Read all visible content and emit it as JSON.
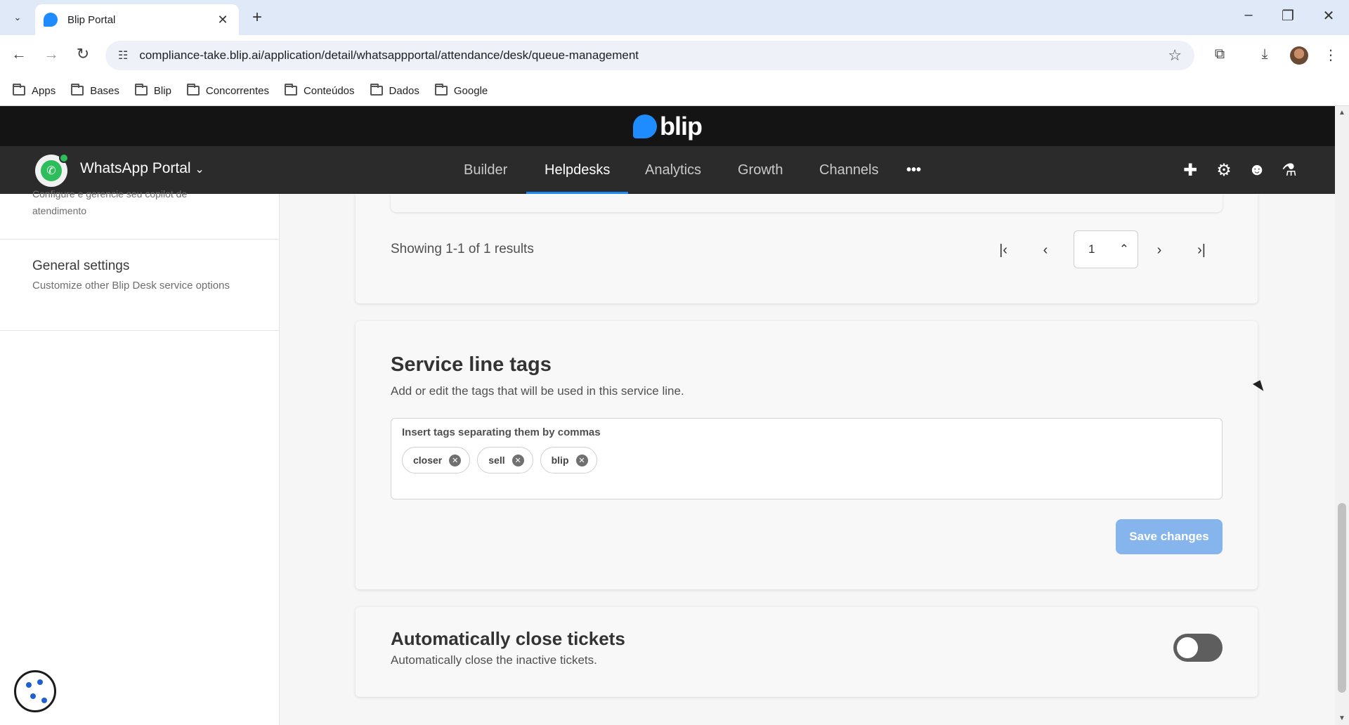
{
  "browser": {
    "tab_title": "Blip Portal",
    "url": "compliance-take.blip.ai/application/detail/whatsappportal/attendance/desk/queue-management",
    "bookmarks": [
      "Apps",
      "Bases",
      "Blip",
      "Concorrentes",
      "Conteúdos",
      "Dados",
      "Google"
    ]
  },
  "header": {
    "brand": "blip",
    "bot_name": "WhatsApp Portal",
    "nav": [
      "Builder",
      "Helpdesks",
      "Analytics",
      "Growth",
      "Channels"
    ],
    "active_nav": "Helpdesks",
    "more": "•••"
  },
  "sidebar": {
    "partial_line1": "Configure e gerencie seu copilot de",
    "partial_line2": "atendimento",
    "general_title": "General settings",
    "general_desc": "Customize other Blip Desk service options"
  },
  "pagination": {
    "showing": "Showing 1-1 of 1 results",
    "page": "1"
  },
  "tags_card": {
    "title": "Service line tags",
    "subtitle": "Add or edit the tags that will be used in this service line.",
    "input_label": "Insert tags separating them by commas",
    "tags": [
      "closer",
      "sell",
      "blip"
    ],
    "save_label": "Save changes"
  },
  "close_card": {
    "title": "Automatically close tickets",
    "subtitle": "Automatically close the inactive tickets.",
    "enabled": false
  },
  "colors": {
    "accent": "#1e8cff",
    "save_disabled": "#86b4ec",
    "whatsapp": "#2dbd5b"
  }
}
